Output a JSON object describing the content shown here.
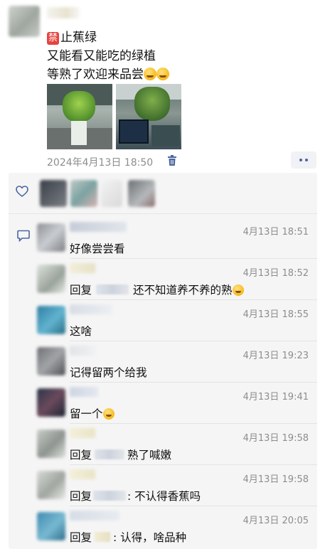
{
  "post": {
    "line1": "止蕉绿",
    "ban_label": "禁",
    "line2": "又能看又能吃的绿植",
    "line3": "等熟了欢迎来品尝",
    "timestamp": "2024年4月13日 18:50"
  },
  "comments": [
    {
      "time": "4月13日 18:51",
      "text": "好像尝尝看"
    },
    {
      "time": "4月13日 18:52",
      "reply_prefix": "回复",
      "text": "还不知道养不养的熟"
    },
    {
      "time": "4月13日 18:55",
      "text": "这啥"
    },
    {
      "time": "4月13日 19:23",
      "text": "记得留两个给我"
    },
    {
      "time": "4月13日 19:41",
      "text": "留一个"
    },
    {
      "time": "4月13日 19:58",
      "reply_prefix": "回复",
      "text": "熟了喊嫩"
    },
    {
      "time": "4月13日 19:58",
      "reply_prefix": "回复",
      "text": ": 不认得香蕉吗"
    },
    {
      "time": "4月13日 20:05",
      "reply_prefix": "回复",
      "text": ": 认得，啥品种"
    }
  ],
  "icons": [
    "trash-icon",
    "more-dots-icon",
    "heart-icon",
    "comment-icon"
  ],
  "colors": {
    "link_blue": "#4b66a0",
    "ban_red": "#e64340",
    "meta_gray": "#8d8d8d",
    "panel_bg": "#f5f5f5"
  }
}
